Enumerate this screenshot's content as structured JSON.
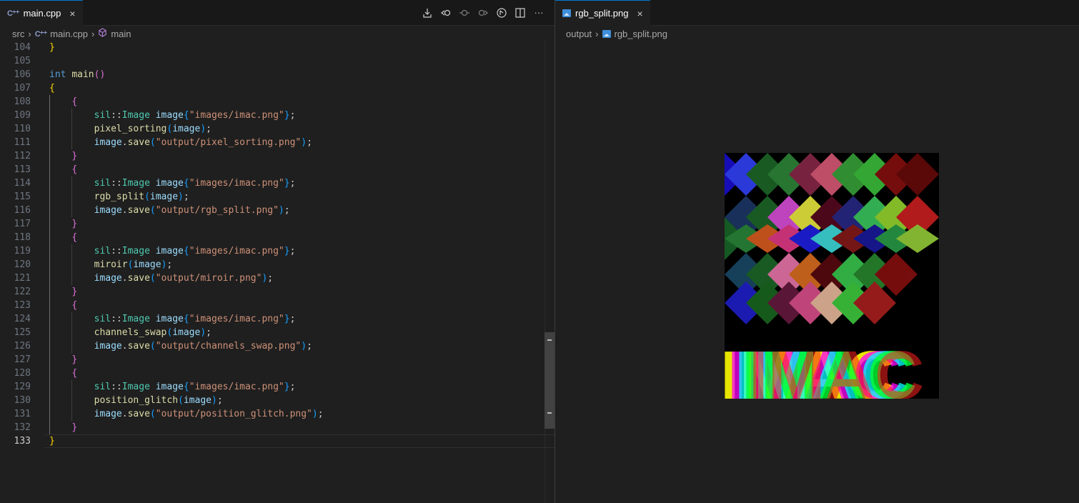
{
  "left_tab": {
    "icon": "cpp-file-icon",
    "label": "main.cpp",
    "close": "×"
  },
  "breadcrumb_left": {
    "folder": "src",
    "file": "main.cpp",
    "symbol": "main"
  },
  "toolbar": [
    "compare-changes-icon",
    "go-back-icon",
    "circle-icon",
    "go-forward-icon",
    "compare-icon",
    "split-editor-icon",
    "more-actions-icon"
  ],
  "right_tab": {
    "icon": "image-file-icon",
    "label": "rgb_split.png",
    "close": "×"
  },
  "breadcrumb_right": {
    "folder": "output",
    "file": "rgb_split.png"
  },
  "current_line": "133",
  "code_lines": [
    {
      "n": "104",
      "t": [
        [
          "}",
          "b1"
        ]
      ]
    },
    {
      "n": "105",
      "t": []
    },
    {
      "n": "106",
      "t": [
        [
          "int",
          "k-type"
        ],
        [
          " ",
          "k-p"
        ],
        [
          "main",
          "k-fn"
        ],
        [
          "()",
          "b2"
        ]
      ]
    },
    {
      "n": "107",
      "t": [
        [
          "{",
          "b1"
        ]
      ]
    },
    {
      "n": "108",
      "t": [
        [
          "    ",
          "k-p"
        ],
        [
          "{",
          "b2"
        ]
      ]
    },
    {
      "n": "109",
      "t": [
        [
          "        ",
          "k-p"
        ],
        [
          "sil",
          "k-ns"
        ],
        [
          "::",
          "k-p"
        ],
        [
          "Image",
          "k-ns"
        ],
        [
          " ",
          "k-p"
        ],
        [
          "image",
          "k-var"
        ],
        [
          "{",
          "b3"
        ],
        [
          "\"images/imac.png\"",
          "k-str"
        ],
        [
          "}",
          "b3"
        ],
        [
          ";",
          "k-p"
        ]
      ]
    },
    {
      "n": "110",
      "t": [
        [
          "        ",
          "k-p"
        ],
        [
          "pixel_sorting",
          "k-fn"
        ],
        [
          "(",
          "b3"
        ],
        [
          "image",
          "k-var"
        ],
        [
          ")",
          "b3"
        ],
        [
          ";",
          "k-p"
        ]
      ]
    },
    {
      "n": "111",
      "t": [
        [
          "        ",
          "k-p"
        ],
        [
          "image",
          "k-var"
        ],
        [
          ".",
          "k-p"
        ],
        [
          "save",
          "k-fn"
        ],
        [
          "(",
          "b3"
        ],
        [
          "\"output/pixel_sorting.png\"",
          "k-str"
        ],
        [
          ")",
          "b3"
        ],
        [
          ";",
          "k-p"
        ]
      ]
    },
    {
      "n": "112",
      "t": [
        [
          "    ",
          "k-p"
        ],
        [
          "}",
          "b2"
        ]
      ]
    },
    {
      "n": "113",
      "t": [
        [
          "    ",
          "k-p"
        ],
        [
          "{",
          "b2"
        ]
      ]
    },
    {
      "n": "114",
      "t": [
        [
          "        ",
          "k-p"
        ],
        [
          "sil",
          "k-ns"
        ],
        [
          "::",
          "k-p"
        ],
        [
          "Image",
          "k-ns"
        ],
        [
          " ",
          "k-p"
        ],
        [
          "image",
          "k-var"
        ],
        [
          "{",
          "b3"
        ],
        [
          "\"images/imac.png\"",
          "k-str"
        ],
        [
          "}",
          "b3"
        ],
        [
          ";",
          "k-p"
        ]
      ]
    },
    {
      "n": "115",
      "t": [
        [
          "        ",
          "k-p"
        ],
        [
          "rgb_split",
          "k-fn"
        ],
        [
          "(",
          "b3"
        ],
        [
          "image",
          "k-var"
        ],
        [
          ")",
          "b3"
        ],
        [
          ";",
          "k-p"
        ]
      ]
    },
    {
      "n": "116",
      "t": [
        [
          "        ",
          "k-p"
        ],
        [
          "image",
          "k-var"
        ],
        [
          ".",
          "k-p"
        ],
        [
          "save",
          "k-fn"
        ],
        [
          "(",
          "b3"
        ],
        [
          "\"output/rgb_split.png\"",
          "k-str"
        ],
        [
          ")",
          "b3"
        ],
        [
          ";",
          "k-p"
        ]
      ]
    },
    {
      "n": "117",
      "t": [
        [
          "    ",
          "k-p"
        ],
        [
          "}",
          "b2"
        ]
      ]
    },
    {
      "n": "118",
      "t": [
        [
          "    ",
          "k-p"
        ],
        [
          "{",
          "b2"
        ]
      ]
    },
    {
      "n": "119",
      "t": [
        [
          "        ",
          "k-p"
        ],
        [
          "sil",
          "k-ns"
        ],
        [
          "::",
          "k-p"
        ],
        [
          "Image",
          "k-ns"
        ],
        [
          " ",
          "k-p"
        ],
        [
          "image",
          "k-var"
        ],
        [
          "{",
          "b3"
        ],
        [
          "\"images/imac.png\"",
          "k-str"
        ],
        [
          "}",
          "b3"
        ],
        [
          ";",
          "k-p"
        ]
      ]
    },
    {
      "n": "120",
      "t": [
        [
          "        ",
          "k-p"
        ],
        [
          "miroir",
          "k-fn"
        ],
        [
          "(",
          "b3"
        ],
        [
          "image",
          "k-var"
        ],
        [
          ")",
          "b3"
        ],
        [
          ";",
          "k-p"
        ]
      ]
    },
    {
      "n": "121",
      "t": [
        [
          "        ",
          "k-p"
        ],
        [
          "image",
          "k-var"
        ],
        [
          ".",
          "k-p"
        ],
        [
          "save",
          "k-fn"
        ],
        [
          "(",
          "b3"
        ],
        [
          "\"output/miroir.png\"",
          "k-str"
        ],
        [
          ")",
          "b3"
        ],
        [
          ";",
          "k-p"
        ]
      ]
    },
    {
      "n": "122",
      "t": [
        [
          "    ",
          "k-p"
        ],
        [
          "}",
          "b2"
        ]
      ]
    },
    {
      "n": "123",
      "t": [
        [
          "    ",
          "k-p"
        ],
        [
          "{",
          "b2"
        ]
      ]
    },
    {
      "n": "124",
      "t": [
        [
          "        ",
          "k-p"
        ],
        [
          "sil",
          "k-ns"
        ],
        [
          "::",
          "k-p"
        ],
        [
          "Image",
          "k-ns"
        ],
        [
          " ",
          "k-p"
        ],
        [
          "image",
          "k-var"
        ],
        [
          "{",
          "b3"
        ],
        [
          "\"images/imac.png\"",
          "k-str"
        ],
        [
          "}",
          "b3"
        ],
        [
          ";",
          "k-p"
        ]
      ]
    },
    {
      "n": "125",
      "t": [
        [
          "        ",
          "k-p"
        ],
        [
          "channels_swap",
          "k-fn"
        ],
        [
          "(",
          "b3"
        ],
        [
          "image",
          "k-var"
        ],
        [
          ")",
          "b3"
        ],
        [
          ";",
          "k-p"
        ]
      ]
    },
    {
      "n": "126",
      "t": [
        [
          "        ",
          "k-p"
        ],
        [
          "image",
          "k-var"
        ],
        [
          ".",
          "k-p"
        ],
        [
          "save",
          "k-fn"
        ],
        [
          "(",
          "b3"
        ],
        [
          "\"output/channels_swap.png\"",
          "k-str"
        ],
        [
          ")",
          "b3"
        ],
        [
          ";",
          "k-p"
        ]
      ]
    },
    {
      "n": "127",
      "t": [
        [
          "    ",
          "k-p"
        ],
        [
          "}",
          "b2"
        ]
      ]
    },
    {
      "n": "128",
      "t": [
        [
          "    ",
          "k-p"
        ],
        [
          "{",
          "b2"
        ]
      ]
    },
    {
      "n": "129",
      "t": [
        [
          "        ",
          "k-p"
        ],
        [
          "sil",
          "k-ns"
        ],
        [
          "::",
          "k-p"
        ],
        [
          "Image",
          "k-ns"
        ],
        [
          " ",
          "k-p"
        ],
        [
          "image",
          "k-var"
        ],
        [
          "{",
          "b3"
        ],
        [
          "\"images/imac.png\"",
          "k-str"
        ],
        [
          "}",
          "b3"
        ],
        [
          ";",
          "k-p"
        ]
      ]
    },
    {
      "n": "130",
      "t": [
        [
          "        ",
          "k-p"
        ],
        [
          "position_glitch",
          "k-fn"
        ],
        [
          "(",
          "b3"
        ],
        [
          "image",
          "k-var"
        ],
        [
          ")",
          "b3"
        ],
        [
          ";",
          "k-p"
        ]
      ]
    },
    {
      "n": "131",
      "t": [
        [
          "        ",
          "k-p"
        ],
        [
          "image",
          "k-var"
        ],
        [
          ".",
          "k-p"
        ],
        [
          "save",
          "k-fn"
        ],
        [
          "(",
          "b3"
        ],
        [
          "\"output/position_glitch.png\"",
          "k-str"
        ],
        [
          ")",
          "b3"
        ],
        [
          ";",
          "k-p"
        ]
      ]
    },
    {
      "n": "132",
      "t": [
        [
          "    ",
          "k-p"
        ],
        [
          "}",
          "b2"
        ]
      ]
    },
    {
      "n": "133",
      "t": [
        [
          "}",
          "b1"
        ]
      ]
    }
  ],
  "preview_image": {
    "name": "rgb_split.png",
    "logo_text": "IMAC"
  },
  "colors": {
    "editor_bg": "#1f1f1f",
    "tabbar_bg": "#181818",
    "active_tab_border": "#0078d4",
    "string": "#ce9178",
    "function": "#dcdcaa",
    "type": "#569cd6",
    "namespace": "#4ec9b0",
    "variable": "#9cdcfe"
  }
}
